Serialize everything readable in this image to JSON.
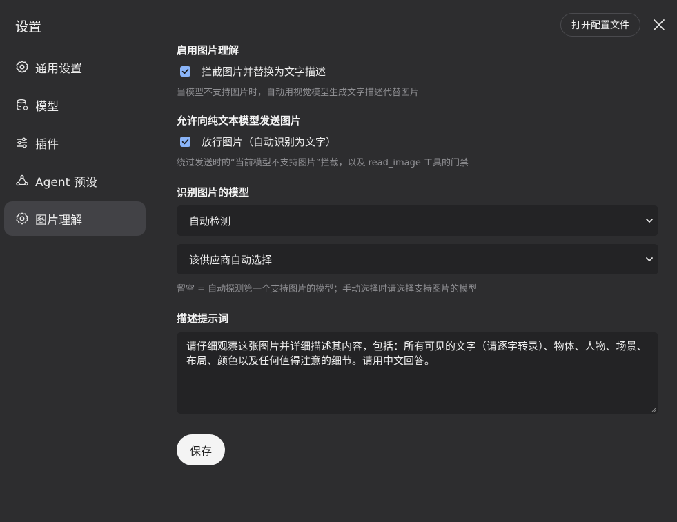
{
  "header": {
    "title": "设置",
    "open_config_label": "打开配置文件"
  },
  "sidebar": {
    "items": [
      {
        "label": "通用设置",
        "icon": "gear-icon"
      },
      {
        "label": "模型",
        "icon": "database-icon"
      },
      {
        "label": "插件",
        "icon": "sliders-icon"
      },
      {
        "label": "Agent 预设",
        "icon": "agent-icon"
      },
      {
        "label": "图片理解",
        "icon": "gear-icon",
        "active": true
      }
    ]
  },
  "image_understanding": {
    "enable_section": {
      "title": "启用图片理解",
      "checkbox_label": "拦截图片并替换为文字描述",
      "checked": true,
      "hint": "当模型不支持图片时，自动用视觉模型生成文字描述代替图片"
    },
    "allow_section": {
      "title": "允许向纯文本模型发送图片",
      "checkbox_label": "放行图片（自动识别为文字）",
      "checked": true,
      "hint": "绕过发送时的“当前模型不支持图片”拦截，以及 read_image 工具的门禁"
    },
    "model_section": {
      "title": "识别图片的模型",
      "provider_select": "自动检测",
      "model_select": "该供应商自动选择",
      "hint": "留空 = 自动探测第一个支持图片的模型；手动选择时请选择支持图片的模型"
    },
    "prompt_section": {
      "title": "描述提示词",
      "text": "请仔细观察这张图片并详细描述其内容，包括：所有可见的文字（请逐字转录）、物体、人物、场景、布局、颜色以及任何值得注意的细节。请用中文回答。"
    },
    "save_label": "保存"
  },
  "colors": {
    "background": "#2d2d2f",
    "active_item": "#424246",
    "checkbox": "#8ab4f8",
    "input_bg": "#232325"
  }
}
